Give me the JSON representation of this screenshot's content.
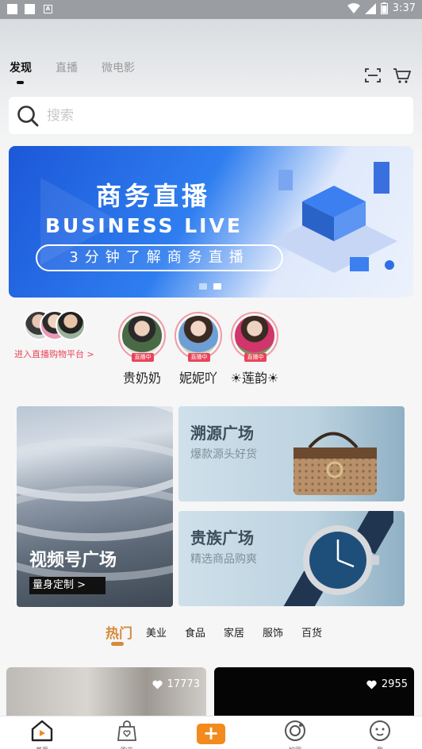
{
  "status_bar": {
    "time": "3:37"
  },
  "header": {
    "tabs": [
      {
        "label": "发现",
        "active": true
      },
      {
        "label": "直播",
        "active": false
      },
      {
        "label": "微电影",
        "active": false
      }
    ],
    "icons": [
      "scan-icon",
      "cart-icon"
    ]
  },
  "search": {
    "placeholder": "搜索"
  },
  "banner": {
    "title": "商务直播",
    "subtitle": "BUSINESS LIVE",
    "pill": "3分钟了解商务直播",
    "page_count": 2,
    "current_page": 2
  },
  "live": {
    "enter_label": "进入直播购物平台",
    "users": [
      {
        "name": "贵奶奶",
        "badge": "直播中"
      },
      {
        "name": "妮妮吖",
        "badge": "直播中"
      },
      {
        "name": "☀莲韵☀",
        "badge": "直播中"
      }
    ]
  },
  "cards": {
    "video": {
      "title": "视频号广场",
      "button": "量身定制 >"
    },
    "trace": {
      "title": "溯源广场",
      "subtitle": "爆款源头好货"
    },
    "noble": {
      "title": "贵族广场",
      "subtitle": "精选商品购爽"
    }
  },
  "categories": [
    {
      "label": "热门",
      "active": true
    },
    {
      "label": "美业",
      "active": false
    },
    {
      "label": "食品",
      "active": false
    },
    {
      "label": "家居",
      "active": false
    },
    {
      "label": "服饰",
      "active": false
    },
    {
      "label": "百货",
      "active": false
    }
  ],
  "feed": [
    {
      "likes": "17773"
    },
    {
      "likes": "2955"
    }
  ],
  "bottom_nav": [
    {
      "label": "首页",
      "icon": "home-icon",
      "active": true
    },
    {
      "label": "购商",
      "icon": "shopping-bag-icon",
      "active": false
    },
    {
      "label": "",
      "icon": "plus-icon",
      "active": false
    },
    {
      "label": "拍圈",
      "icon": "circle-icon",
      "active": false
    },
    {
      "label": "我",
      "icon": "profile-icon",
      "active": false
    }
  ],
  "colors": {
    "accent": "#d58a3d",
    "live_red": "#e8455a",
    "plus_orange": "#f38a1d"
  }
}
